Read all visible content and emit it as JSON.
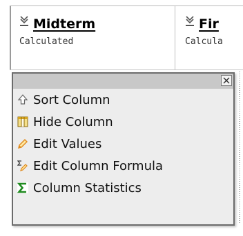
{
  "columns": [
    {
      "title": "Midterm",
      "subtitle": "Calculated"
    },
    {
      "title": "Fir",
      "subtitle": "Calcula"
    }
  ],
  "menu": {
    "close_icon": "close-icon",
    "items": [
      {
        "label": "Sort Column",
        "icon": "sort-icon"
      },
      {
        "label": "Hide Column",
        "icon": "hide-column-icon"
      },
      {
        "label": "Edit Values",
        "icon": "pencil-icon"
      },
      {
        "label": "Edit Column Formula",
        "icon": "formula-icon"
      },
      {
        "label": "Column Statistics",
        "icon": "sigma-icon"
      }
    ]
  },
  "colors": {
    "menu_bg": "#ededed",
    "menu_title_bg": "#c8c8c8",
    "menu_border": "#6b6b6b",
    "sigma_green": "#1f8a1f",
    "pencil_orange": "#e08a1e"
  }
}
